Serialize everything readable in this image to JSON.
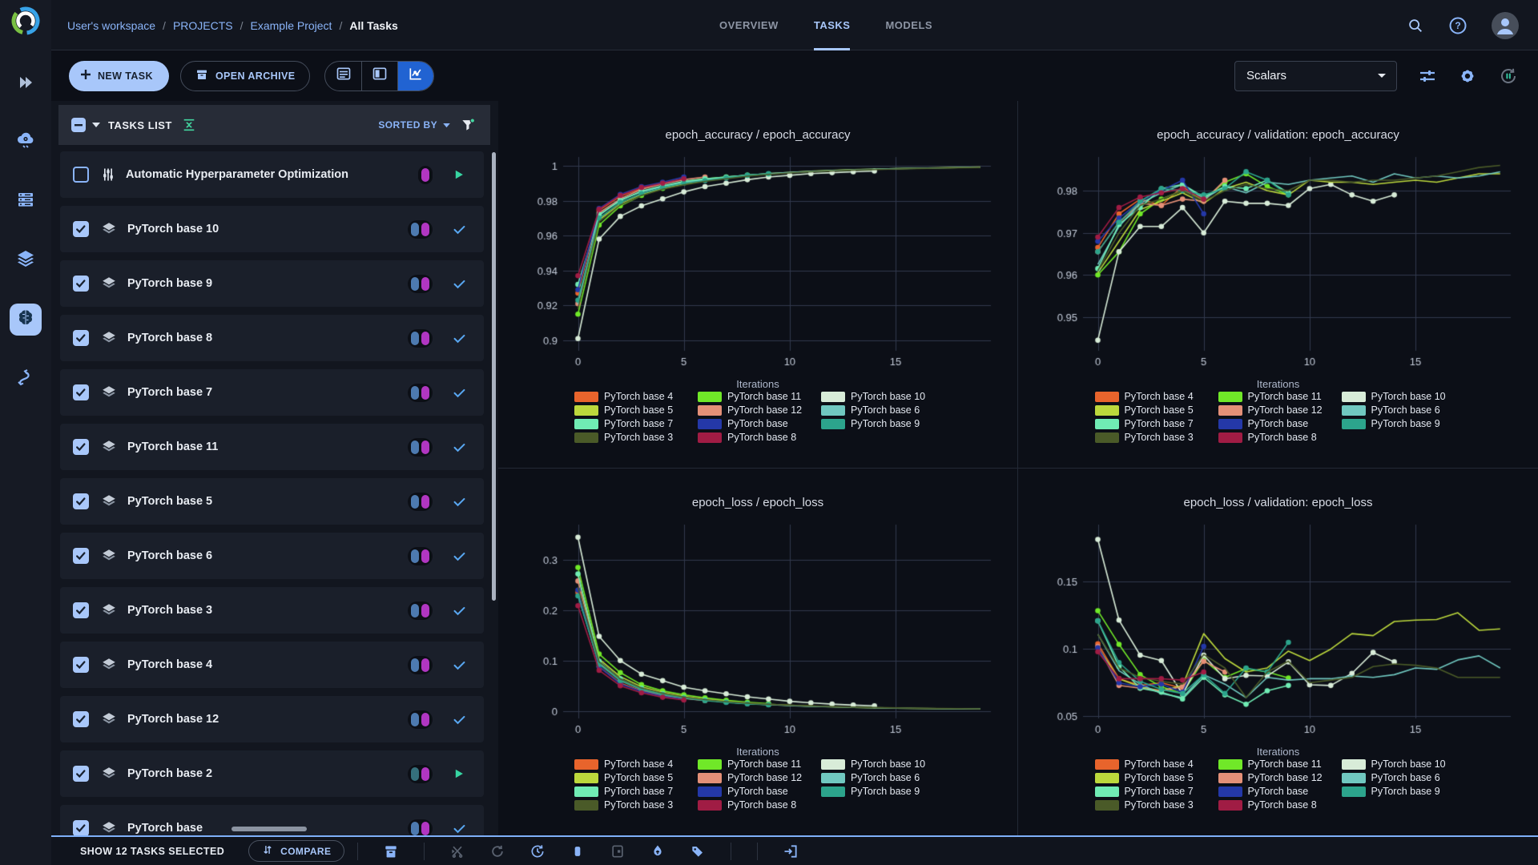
{
  "breadcrumb": {
    "items": [
      "User's workspace",
      "PROJECTS",
      "Example Project",
      "All Tasks"
    ]
  },
  "tabs": [
    {
      "label": "OVERVIEW",
      "active": false
    },
    {
      "label": "TASKS",
      "active": true
    },
    {
      "label": "MODELS",
      "active": false
    }
  ],
  "topbar_icons": [
    "search-icon",
    "help-icon",
    "avatar"
  ],
  "sidebar": {
    "items": [
      "projects-icon",
      "pipelines-icon",
      "workers-icon",
      "datasets-icon",
      "applications-icon",
      "orchestration-icon"
    ],
    "active_item": "applications-icon"
  },
  "toolbar": {
    "new_task_label": "NEW TASK",
    "open_archive_label": "OPEN ARCHIVE",
    "view_toggle": [
      "table-view-icon",
      "split-view-icon",
      "chart-view-icon"
    ],
    "view_toggle_active": "chart-view-icon",
    "metric_selector_value": "Scalars",
    "right_icons": [
      "tune-icon",
      "gear-icon",
      "auto-refresh-icon"
    ]
  },
  "tasks_panel": {
    "header": {
      "title": "TASKS LIST",
      "sorted_by_label": "SORTED BY",
      "select_all_state": "indeterminate"
    },
    "rows": [
      {
        "name": "Automatic Hyperparameter Optimization",
        "icon": "sliders-icon",
        "checked": false,
        "pills": [
          "magenta"
        ],
        "status": "running"
      },
      {
        "name": "PyTorch base 10",
        "icon": "stack-icon",
        "checked": true,
        "pills": [
          "blue",
          "magenta"
        ],
        "status": "completed"
      },
      {
        "name": "PyTorch base 9",
        "icon": "stack-icon",
        "checked": true,
        "pills": [
          "blue",
          "magenta"
        ],
        "status": "completed"
      },
      {
        "name": "PyTorch base 8",
        "icon": "stack-icon",
        "checked": true,
        "pills": [
          "blue",
          "magenta"
        ],
        "status": "completed"
      },
      {
        "name": "PyTorch base 7",
        "icon": "stack-icon",
        "checked": true,
        "pills": [
          "blue",
          "magenta"
        ],
        "status": "completed"
      },
      {
        "name": "PyTorch base 11",
        "icon": "stack-icon",
        "checked": true,
        "pills": [
          "blue",
          "magenta"
        ],
        "status": "completed"
      },
      {
        "name": "PyTorch base 5",
        "icon": "stack-icon",
        "checked": true,
        "pills": [
          "blue",
          "magenta"
        ],
        "status": "completed"
      },
      {
        "name": "PyTorch base 6",
        "icon": "stack-icon",
        "checked": true,
        "pills": [
          "blue",
          "magenta"
        ],
        "status": "completed"
      },
      {
        "name": "PyTorch base 3",
        "icon": "stack-icon",
        "checked": true,
        "pills": [
          "blue",
          "magenta"
        ],
        "status": "completed"
      },
      {
        "name": "PyTorch base 4",
        "icon": "stack-icon",
        "checked": true,
        "pills": [
          "blue",
          "magenta"
        ],
        "status": "completed"
      },
      {
        "name": "PyTorch base 12",
        "icon": "stack-icon",
        "checked": true,
        "pills": [
          "blue",
          "magenta"
        ],
        "status": "completed"
      },
      {
        "name": "PyTorch base 2",
        "icon": "stack-icon",
        "checked": true,
        "pills": [
          "teal",
          "magenta"
        ],
        "status": "running"
      },
      {
        "name": "PyTorch base",
        "icon": "stack-icon",
        "checked": true,
        "pills": [
          "blue",
          "magenta"
        ],
        "status": "completed"
      }
    ],
    "pill_colors": {
      "blue": "#4d7ab0",
      "magenta": "#b136c2",
      "teal": "#35707c"
    }
  },
  "footer": {
    "selected_text": "SHOW 12 TASKS SELECTED",
    "compare_label": "COMPARE",
    "actions": [
      {
        "icon": "archive-icon",
        "enabled": true
      },
      {
        "icon": "abort-icon",
        "enabled": false
      },
      {
        "icon": "reset-icon",
        "enabled": false
      },
      {
        "icon": "enqueue-icon",
        "enabled": true
      },
      {
        "icon": "stop-icon",
        "enabled": true
      },
      {
        "icon": "view-frame-icon",
        "enabled": false
      },
      {
        "icon": "publish-icon",
        "enabled": true
      },
      {
        "icon": "tags-icon",
        "enabled": true
      },
      {
        "icon": "move-to-project-icon",
        "enabled": true
      }
    ]
  },
  "colors": {
    "accent_blue": "#8ab4f8",
    "button_blue_fill": "#a8c7fa",
    "active_toggle_blue": "#2163d2",
    "check_blue": "#58a6f0",
    "running_green": "#37d5a2",
    "filter_dot_green": "#43d6a0",
    "magenta_badge": "#b136c2",
    "grid": "#323a4e"
  },
  "chart_data": {
    "type": "line",
    "shared": {
      "xlabel": "Iterations",
      "x_ticks": [
        0,
        5,
        10,
        15
      ],
      "xlim": [
        -0.7,
        19.5
      ],
      "legend_position": "bottom",
      "series_meta": [
        {
          "name": "PyTorch base 4",
          "color": "#e8642c"
        },
        {
          "name": "PyTorch base 11",
          "color": "#70e828"
        },
        {
          "name": "PyTorch base 10",
          "color": "#d8ecd8"
        },
        {
          "name": "PyTorch base 5",
          "color": "#bcd83c"
        },
        {
          "name": "PyTorch base 12",
          "color": "#e49078"
        },
        {
          "name": "PyTorch base 6",
          "color": "#70c8c0"
        },
        {
          "name": "PyTorch base 7",
          "color": "#70ecb4"
        },
        {
          "name": "PyTorch base",
          "color": "#2438a8"
        },
        {
          "name": "PyTorch base 9",
          "color": "#2ca48c"
        },
        {
          "name": "PyTorch base 3",
          "color": "#4a5a28"
        },
        {
          "name": "PyTorch base 8",
          "color": "#a01c44"
        }
      ]
    },
    "charts": [
      {
        "title": "epoch_accuracy / epoch_accuracy",
        "y_ticks": [
          1,
          0.98,
          0.96,
          0.94,
          0.92,
          0.9
        ],
        "ylim": [
          0.894,
          1.005
        ],
        "series": {
          "PyTorch base 4": [
            0.927,
            0.9745,
            0.9825,
            0.987,
            0.99,
            0.9925
          ],
          "PyTorch base 11": [
            0.915,
            0.966,
            0.977,
            0.983,
            0.987,
            0.991,
            0.9925,
            0.9935,
            0.9945,
            0.995
          ],
          "PyTorch base 10": [
            0.901,
            0.958,
            0.971,
            0.977,
            0.981,
            0.985,
            0.988,
            0.99,
            0.992,
            0.9935,
            0.9945,
            0.9955,
            0.996,
            0.9965,
            0.997
          ],
          "PyTorch base 5": [
            0.92,
            0.969,
            0.978,
            0.9835,
            0.987,
            0.9895,
            0.9915,
            0.993,
            0.9945,
            0.9955,
            0.9962,
            0.9968,
            0.9973,
            0.9977,
            0.998,
            0.9983,
            0.9986,
            0.9988,
            0.999,
            0.9992
          ],
          "PyTorch base 12": [
            0.921,
            0.973,
            0.981,
            0.9865,
            0.9895,
            0.992,
            0.9935
          ],
          "PyTorch base 6": [
            0.9205,
            0.9715,
            0.9805,
            0.985,
            0.988,
            0.9905,
            0.992,
            0.9935,
            0.9945,
            0.9955,
            0.9962,
            0.9967,
            0.9972,
            0.9976,
            0.998,
            0.9983,
            0.9985,
            0.9987,
            0.9989,
            0.999
          ],
          "PyTorch base 7": [
            0.932,
            0.972,
            0.98,
            0.9855,
            0.9885,
            0.991,
            0.9925,
            0.9935,
            0.9945,
            0.9952
          ],
          "PyTorch base": [
            0.929,
            0.9755,
            0.9835,
            0.988,
            0.9905,
            0.9935
          ],
          "PyTorch base 9": [
            0.923,
            0.97,
            0.979,
            0.984,
            0.9875,
            0.99,
            0.9915,
            0.993,
            0.9945,
            0.9955
          ],
          "PyTorch base 3": [
            0.918,
            0.968,
            0.9775,
            0.983,
            0.9865,
            0.989,
            0.991,
            0.9925,
            0.994,
            0.995,
            0.9958,
            0.9965,
            0.997,
            0.9975,
            0.9978,
            0.9981,
            0.9984,
            0.9986,
            0.9988,
            0.999
          ],
          "PyTorch base 8": [
            0.937,
            0.975,
            0.983,
            0.9875,
            0.99,
            0.9925
          ]
        }
      },
      {
        "title": "epoch_accuracy / validation: epoch_accuracy",
        "y_ticks": [
          0.98,
          0.97,
          0.96,
          0.95
        ],
        "ylim": [
          0.942,
          0.988
        ],
        "series": {
          "PyTorch base 4": [
            0.9665,
            0.9745,
            0.978,
            0.9765,
            0.981,
            0.9775
          ],
          "PyTorch base 11": [
            0.96,
            0.9655,
            0.9745,
            0.978,
            0.98,
            0.978,
            0.982,
            0.984,
            0.981,
            0.979
          ],
          "PyTorch base 10": [
            0.9445,
            0.9655,
            0.9715,
            0.9715,
            0.976,
            0.97,
            0.9775,
            0.977,
            0.977,
            0.9765,
            0.9805,
            0.9815,
            0.979,
            0.9775,
            0.979
          ],
          "PyTorch base 5": [
            0.9605,
            0.968,
            0.9755,
            0.9775,
            0.9795,
            0.977,
            0.9805,
            0.982,
            0.98,
            0.979,
            0.9825,
            0.982,
            0.982,
            0.9815,
            0.982,
            0.9825,
            0.982,
            0.983,
            0.984,
            0.984
          ],
          "PyTorch base 12": [
            0.9655,
            0.9725,
            0.977,
            0.9765,
            0.978,
            0.9775,
            0.9825
          ],
          "PyTorch base 6": [
            0.9625,
            0.9715,
            0.977,
            0.9795,
            0.9815,
            0.978,
            0.981,
            0.9795,
            0.982,
            0.9815,
            0.9825,
            0.983,
            0.9835,
            0.982,
            0.984,
            0.983,
            0.9835,
            0.983,
            0.9835,
            0.9845
          ],
          "PyTorch base 7": [
            0.9615,
            0.972,
            0.976,
            0.9805,
            0.9815,
            0.9785,
            0.981,
            0.9805,
            0.9825,
            0.9795
          ],
          "PyTorch base": [
            0.968,
            0.9735,
            0.9775,
            0.98,
            0.9825,
            0.9745
          ],
          "PyTorch base 9": [
            0.9655,
            0.9725,
            0.9775,
            0.9805,
            0.98,
            0.979,
            0.9805,
            0.9845,
            0.9825,
            0.979
          ],
          "PyTorch base 3": [
            0.961,
            0.97,
            0.9765,
            0.978,
            0.98,
            0.9775,
            0.98,
            0.9815,
            0.9805,
            0.98,
            0.9825,
            0.9825,
            0.982,
            0.9825,
            0.9825,
            0.983,
            0.9835,
            0.9845,
            0.9855,
            0.986
          ],
          "PyTorch base 8": [
            0.969,
            0.976,
            0.9785,
            0.9795,
            0.9805,
            0.978
          ]
        }
      },
      {
        "title": "epoch_loss / epoch_loss",
        "y_ticks": [
          0.3,
          0.2,
          0.1,
          0
        ],
        "ylim": [
          -0.015,
          0.37
        ],
        "series": {
          "PyTorch base 4": [
            0.235,
            0.088,
            0.055,
            0.04,
            0.03,
            0.024
          ],
          "PyTorch base 11": [
            0.285,
            0.113,
            0.076,
            0.052,
            0.04,
            0.032,
            0.026,
            0.021,
            0.017,
            0.0145
          ],
          "PyTorch base 10": [
            0.345,
            0.148,
            0.1,
            0.073,
            0.06,
            0.047,
            0.04,
            0.034,
            0.028,
            0.0235,
            0.019,
            0.016,
            0.0135,
            0.0115,
            0.01
          ],
          "PyTorch base 5": [
            0.27,
            0.103,
            0.068,
            0.048,
            0.037,
            0.029,
            0.0235,
            0.019,
            0.0155,
            0.013,
            0.011,
            0.0095,
            0.008,
            0.007,
            0.006,
            0.0055,
            0.005,
            0.0045,
            0.004,
            0.0038
          ],
          "PyTorch base 12": [
            0.258,
            0.095,
            0.06,
            0.0425,
            0.0315,
            0.025,
            0.0205
          ],
          "PyTorch base 6": [
            0.232,
            0.094,
            0.0615,
            0.0435,
            0.0335,
            0.0265,
            0.0215,
            0.0175,
            0.0145,
            0.0125,
            0.0105,
            0.009,
            0.008,
            0.007,
            0.0062,
            0.0055,
            0.005,
            0.0045,
            0.0042,
            0.004
          ],
          "PyTorch base 7": [
            0.272,
            0.0985,
            0.0635,
            0.045,
            0.034,
            0.0265,
            0.0215,
            0.0175,
            0.0145,
            0.0125
          ],
          "PyTorch base": [
            0.24,
            0.0875,
            0.0535,
            0.0385,
            0.029,
            0.023
          ],
          "PyTorch base 9": [
            0.2285,
            0.0925,
            0.06,
            0.0425,
            0.0325,
            0.0255,
            0.0205,
            0.017,
            0.014,
            0.012
          ],
          "PyTorch base 3": [
            0.2455,
            0.0975,
            0.0635,
            0.0455,
            0.035,
            0.0275,
            0.0225,
            0.0185,
            0.0155,
            0.013,
            0.0112,
            0.0098,
            0.0085,
            0.0075,
            0.0066,
            0.0059,
            0.0053,
            0.0048,
            0.0044,
            0.004
          ],
          "PyTorch base 8": [
            0.209,
            0.0805,
            0.05,
            0.036,
            0.027,
            0.0215
          ]
        }
      },
      {
        "title": "epoch_loss / validation: epoch_loss",
        "y_ticks": [
          0.15,
          0.1,
          0.05
        ],
        "ylim": [
          0.048,
          0.192
        ],
        "series": {
          "PyTorch base 4": [
            0.1035,
            0.0775,
            0.0725,
            0.0745,
            0.0705,
            0.0905
          ],
          "PyTorch base 11": [
            0.128,
            0.103,
            0.0805,
            0.0715,
            0.0665,
            0.0915,
            0.0785,
            0.085,
            0.0825,
            0.078
          ],
          "PyTorch base 10": [
            0.181,
            0.121,
            0.095,
            0.091,
            0.066,
            0.095,
            0.0775,
            0.08,
            0.0795,
            0.09,
            0.073,
            0.0725,
            0.0815,
            0.097,
            0.09
          ],
          "PyTorch base 5": [
            0.1005,
            0.0775,
            0.0715,
            0.0685,
            0.0725,
            0.111,
            0.0925,
            0.0825,
            0.0855,
            0.098,
            0.091,
            0.0995,
            0.111,
            0.1095,
            0.12,
            0.121,
            0.1215,
            0.1265,
            0.1135,
            0.1145
          ],
          "PyTorch base 12": [
            0.1015,
            0.0725,
            0.0705,
            0.0685,
            0.0715,
            0.0905,
            0.0825
          ],
          "PyTorch base 6": [
            0.1105,
            0.0835,
            0.0735,
            0.0665,
            0.0635,
            0.0805,
            0.0735,
            0.0635,
            0.0785,
            0.0765,
            0.0775,
            0.0775,
            0.0795,
            0.0785,
            0.0805,
            0.0855,
            0.0845,
            0.0915,
            0.0945,
            0.0855
          ],
          "PyTorch base 7": [
            0.1205,
            0.0865,
            0.0705,
            0.0675,
            0.0625,
            0.0785,
            0.0655,
            0.0585,
            0.0685,
            0.0725
          ],
          "PyTorch base": [
            0.1005,
            0.0745,
            0.0715,
            0.0735,
            0.0675,
            0.1015
          ],
          "PyTorch base 9": [
            0.1205,
            0.0895,
            0.0755,
            0.0695,
            0.0665,
            0.0805,
            0.0665,
            0.0855,
            0.0825,
            0.1045
          ],
          "PyTorch base 3": [
            0.1105,
            0.0855,
            0.0785,
            0.0755,
            0.0735,
            0.0955,
            0.0855,
            0.0635,
            0.0825,
            0.0905,
            0.0745,
            0.0765,
            0.0785,
            0.0865,
            0.0885,
            0.0875,
            0.0855,
            0.0785,
            0.0785,
            0.0785
          ],
          "PyTorch base 8": [
            0.0975,
            0.0775,
            0.0775,
            0.0775,
            0.0765,
            0.0825
          ]
        }
      }
    ]
  }
}
